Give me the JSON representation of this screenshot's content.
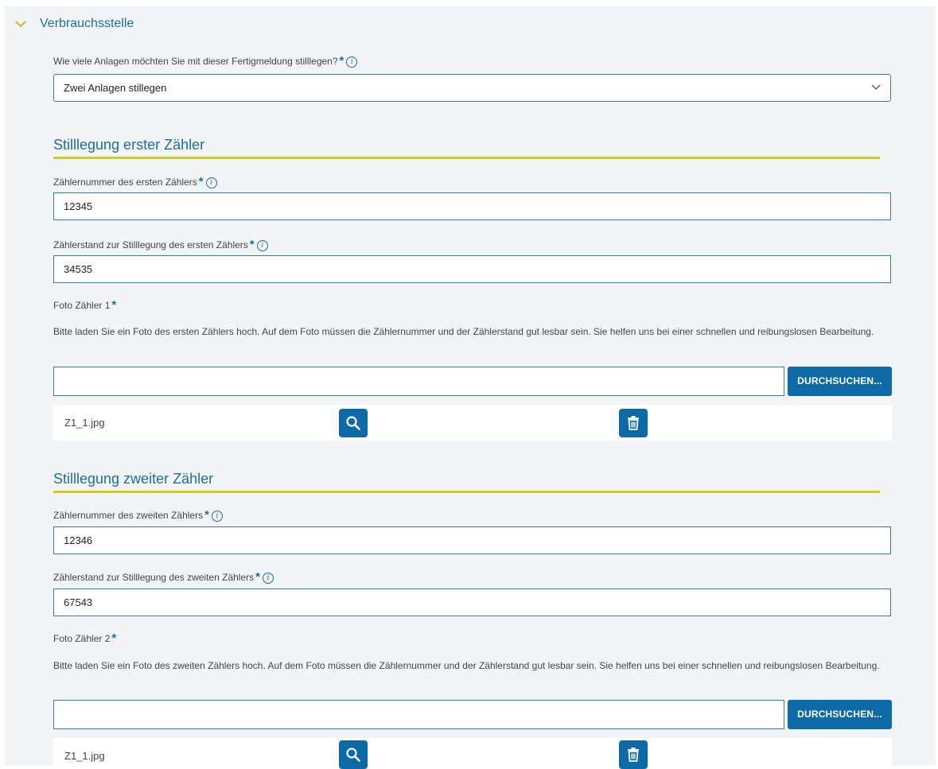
{
  "accordion": {
    "title": "Verbrauchsstelle",
    "icon": "chevron-down-icon"
  },
  "colors": {
    "accent": "#1a6fa3",
    "button": "#0d6aa6",
    "divider": "#d0cc1e",
    "panel": "#f2f4f6"
  },
  "anlagen": {
    "label": "Wie viele Anlagen möchten Sie mit dieser Fertigmeldung stilllegen?",
    "value": "Zwei Anlagen stillegen"
  },
  "required_mark": "*",
  "info_glyph": "i",
  "zaehler1": {
    "title": "Stilllegung erster Zähler",
    "nummer_label": "Zählernummer des ersten Zählers",
    "nummer_value": "12345",
    "stand_label": "Zählerstand zur Stilllegung des ersten Zählers",
    "stand_value": "34535",
    "foto_label": "Foto Zähler 1",
    "foto_help": "Bitte laden Sie ein Foto des ersten Zählers hoch. Auf dem Foto müssen die Zählernummer und der Zählerstand gut lesbar sein. Sie helfen uns bei einer schnellen und reibungslosen Bearbeitung.",
    "browse_label": "DURCHSUCHEN...",
    "file_name": "Z1_1.jpg"
  },
  "zaehler2": {
    "title": "Stilllegung zweiter Zähler",
    "nummer_label": "Zählernummer des zweiten Zählers",
    "nummer_value": "12346",
    "stand_label": "Zählerstand zur Stilllegung des zweiten Zählers",
    "stand_value": "67543",
    "foto_label": "Foto Zähler 2",
    "foto_help": "Bitte laden Sie ein Foto des zweiten Zählers hoch. Auf dem Foto müssen die Zählernummer und der Zählerstand gut lesbar sein. Sie helfen uns bei einer schnellen und reibungslosen Bearbeitung.",
    "browse_label": "DURCHSUCHEN...",
    "file_name": "Z1_1.jpg"
  }
}
